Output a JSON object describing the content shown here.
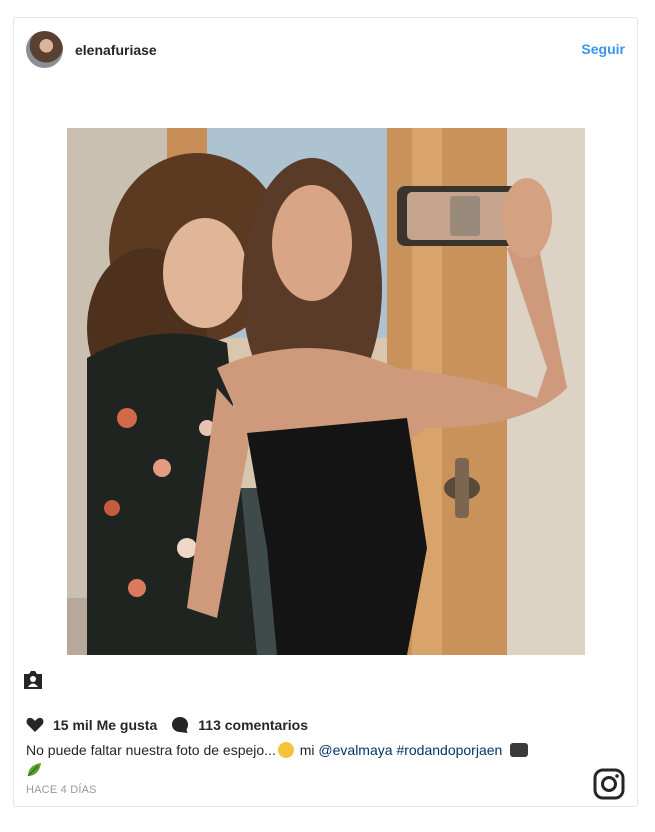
{
  "post": {
    "username": "elenafuriase",
    "follow_label": "Seguir",
    "likes": "15 mil Me gusta",
    "comments": "113 comentarios",
    "caption_text": "No puede faltar nuestra foto de espejo...",
    "caption_mid": " mi ",
    "mention": "@evalmaya",
    "hashtag": "#rodandoporjaen",
    "timestamp": "HACE 4 DÍAS"
  },
  "icons": {
    "like": "heart-icon",
    "comment": "comment-bubble-icon",
    "tag": "tagged-person-icon",
    "brand": "instagram-logo-icon"
  },
  "colors": {
    "link_blue": "#3897f0",
    "caption_link": "#003569",
    "timestamp_gray": "#999999",
    "border": "#e6e6e6"
  }
}
